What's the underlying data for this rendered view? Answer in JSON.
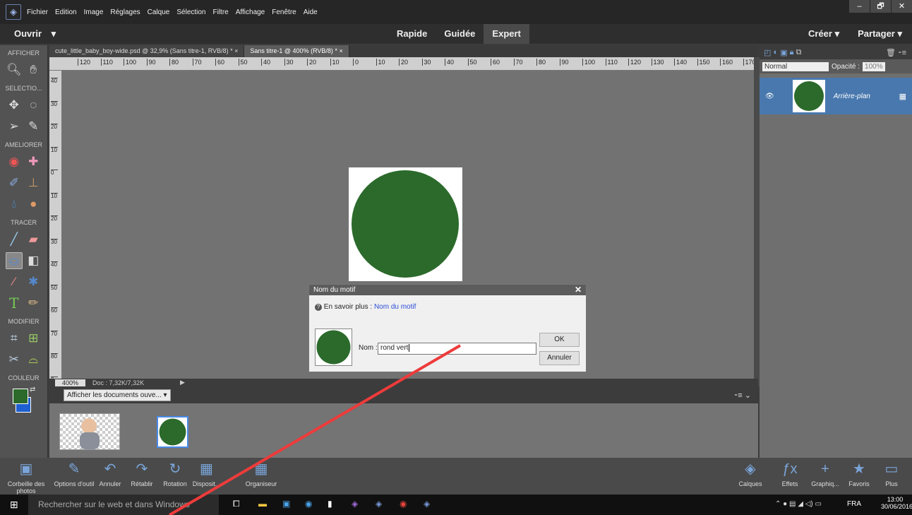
{
  "menubar": {
    "items": [
      "Fichier",
      "Edition",
      "Image",
      "Réglages",
      "Calque",
      "Sélection",
      "Filtre",
      "Affichage",
      "Fenêtre",
      "Aide"
    ]
  },
  "window": {
    "minimize": "–",
    "maximize": "🗗",
    "close": "✕"
  },
  "modebar": {
    "open": "Ouvrir",
    "open_arrow": "▾",
    "modes": [
      "Rapide",
      "Guidée",
      "Expert"
    ],
    "create": "Créer ▾",
    "share": "Partager ▾"
  },
  "toolbox": {
    "sections": [
      "AFFICHER",
      "SELECTIO...",
      "AMELIORER",
      "TRACER",
      "MODIFIER",
      "COULEUR"
    ],
    "fg_color": "#2b6a2b",
    "bg_color": "#1e5fd1"
  },
  "tabs": [
    "cute_little_baby_boy-wide.psd @ 32,9% (Sans titre-1, RVB/8) *",
    "Sans titre-1 @ 400% (RVB/8) *"
  ],
  "tab_close": "×",
  "ruler_h": [
    "120",
    "110",
    "100",
    "90",
    "80",
    "70",
    "60",
    "50",
    "40",
    "30",
    "20",
    "10",
    "0",
    "10",
    "20",
    "30",
    "40",
    "50",
    "60",
    "70",
    "80",
    "90",
    "100",
    "110",
    "120",
    "130",
    "140",
    "150",
    "160",
    "170"
  ],
  "ruler_v": [
    "4 0",
    "3 0",
    "2 0",
    "1 0",
    "0",
    "1 0",
    "2 0",
    "3 0",
    "4 0",
    "5 0",
    "6 0",
    "7 0",
    "8 0",
    "9"
  ],
  "status": {
    "zoom": "400%",
    "doc": "Doc : 7,32K/7,32K",
    "arrow": "▶"
  },
  "bin": {
    "dropdown": "Afficher les documents ouve... ▾",
    "controls": "⁃≡ ⌄"
  },
  "canvas": {
    "circle_color": "#2b6a2b"
  },
  "layers": {
    "blend": "Normal",
    "opacity_label": "Opacité :",
    "opacity": "100%",
    "layer_name": "Arrière-plan"
  },
  "dialog": {
    "title": "Nom du motif",
    "help_prefix": "En savoir plus :",
    "help_link": "Nom du motif",
    "name_label": "Nom :",
    "name_value": "rond vert",
    "ok": "OK",
    "cancel": "Annuler",
    "close": "✕"
  },
  "bottombar": {
    "left": [
      "Corbeille des photos",
      "Options d'outil",
      "Annuler",
      "Rétablir",
      "Rotation",
      "Disposit...",
      "Organiseur"
    ],
    "right": [
      "Calques",
      "Effets",
      "Graphiq...",
      "Favoris",
      "Plus"
    ]
  },
  "taskbar": {
    "search": "Rechercher sur le web et dans Windows",
    "lang": "FRA",
    "time": "13:00",
    "date": "30/06/2016"
  }
}
